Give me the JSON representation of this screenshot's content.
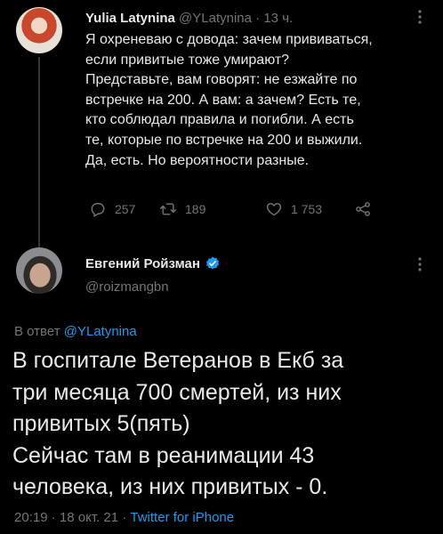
{
  "tweet_main": {
    "author_name": "Yulia Latynina",
    "author_handle": "@YLatynina",
    "separator": "·",
    "time": "13 ч.",
    "text": "Я охреневаю с довода: зачем прививаться,\nесли привитые тоже умирают?\nПредставьте, вам говорят:  не езжайте по\nвстречке на  200. А вам: а зачем?  Есть те,\nкто соблюдал правила и погибли. А есть\nте, которые по встречке на 200 и выжили.\nДа, есть. Но вероятности разные.",
    "replies": "257",
    "retweets": "189",
    "likes": "1 753"
  },
  "tweet_reply": {
    "author_name": "Евгений Ройзман",
    "author_handle": "@roizmangbn",
    "reply_label": "В ответ",
    "reply_to": "@YLatynina",
    "text": "В госпитале Ветеранов в Екб за\nтри месяца 700 смертей, из них\nпривитых 5(пять)\nСейчас там в реанимации 43\nчеловека, из них привитых - 0.",
    "time": "20:19",
    "separator": "·",
    "date": "18 окт. 21",
    "source": "Twitter for iPhone"
  },
  "icons": {
    "reply": "speech-bubble-icon",
    "retweet": "retweet-arrows-icon",
    "like": "heart-outline-icon",
    "share": "share-nodes-icon",
    "more": "vertical-ellipsis-icon",
    "verified": "verified-badge-icon"
  },
  "colors": {
    "background": "#000000",
    "text_primary": "#e7e9ea",
    "text_secondary": "#71767b",
    "link": "#1d9bf0",
    "thread_line": "#333639"
  }
}
